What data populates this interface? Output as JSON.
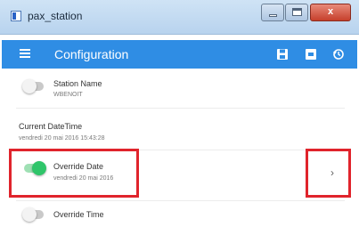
{
  "window": {
    "title": "pax_station",
    "buttons": {
      "minimize": "",
      "maximize": "",
      "close": "x"
    }
  },
  "appbar": {
    "title": "Configuration",
    "icons": [
      "menu-icon",
      "save-icon",
      "load-icon",
      "history-icon"
    ]
  },
  "settings": {
    "station_name": {
      "label": "Station Name",
      "value": "WBENOIT",
      "enabled": false
    },
    "current_datetime": {
      "label": "Current DateTime",
      "value": "vendredi 20 mai 2016 15:43:28"
    },
    "override_date": {
      "label": "Override Date",
      "value": "vendredi 20 mai 2016",
      "enabled": true
    },
    "override_time": {
      "label": "Override Time",
      "enabled": false
    }
  },
  "colors": {
    "appbar": "#2f8de4",
    "toggle_on": "#2fc56a",
    "highlight": "#e0242c"
  }
}
